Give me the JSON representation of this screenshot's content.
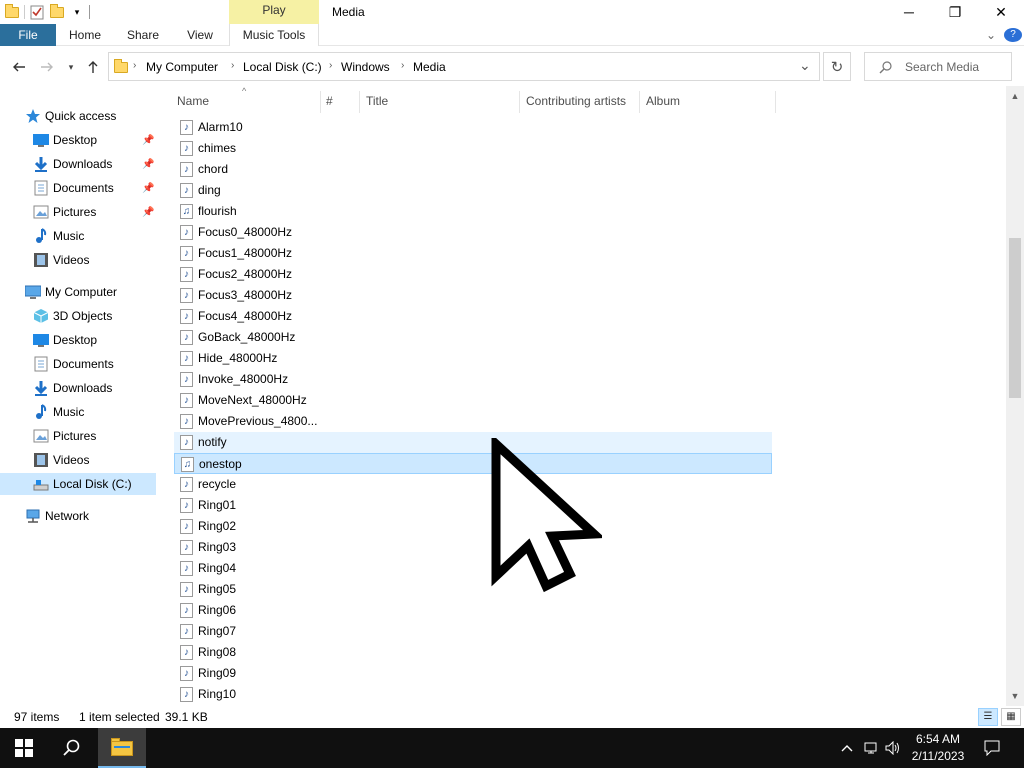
{
  "titlebar": {
    "contextual_tab": "Play",
    "title": "Media",
    "minimize_glyph": "─",
    "maximize_glyph": "❐",
    "close_glyph": "✕"
  },
  "ribbon": {
    "tabs": [
      "File",
      "Home",
      "Share",
      "View",
      "Music Tools"
    ],
    "expand_glyph": "⌄",
    "help_glyph": "?"
  },
  "address_bar": {
    "crumbs": [
      "My Computer",
      "Local Disk (C:)",
      "Windows",
      "Media"
    ],
    "dropdown_glyph": "⌄",
    "refresh_glyph": "↻"
  },
  "search": {
    "placeholder": "Search Media"
  },
  "navigation": {
    "quick_access": {
      "label": "Quick access",
      "items": [
        {
          "label": "Desktop",
          "icon": "desktop-icon",
          "pinned": true
        },
        {
          "label": "Downloads",
          "icon": "downloads-icon",
          "pinned": true
        },
        {
          "label": "Documents",
          "icon": "documents-icon",
          "pinned": true
        },
        {
          "label": "Pictures",
          "icon": "pictures-icon",
          "pinned": true
        },
        {
          "label": "Music",
          "icon": "music-icon",
          "pinned": false
        },
        {
          "label": "Videos",
          "icon": "videos-icon",
          "pinned": false
        }
      ]
    },
    "my_computer": {
      "label": "My Computer",
      "items": [
        {
          "label": "3D Objects",
          "icon": "3d-objects-icon"
        },
        {
          "label": "Desktop",
          "icon": "desktop-icon"
        },
        {
          "label": "Documents",
          "icon": "documents-icon"
        },
        {
          "label": "Downloads",
          "icon": "downloads-icon"
        },
        {
          "label": "Music",
          "icon": "music-icon"
        },
        {
          "label": "Pictures",
          "icon": "pictures-icon"
        },
        {
          "label": "Videos",
          "icon": "videos-icon"
        },
        {
          "label": "Local Disk (C:)",
          "icon": "drive-icon",
          "selected": true
        }
      ]
    },
    "network": {
      "label": "Network"
    }
  },
  "columns": {
    "name": "Name",
    "number": "#",
    "title": "Title",
    "artists": "Contributing artists",
    "album": "Album"
  },
  "files": [
    {
      "name": "Alarm10",
      "icon": "audio-file-icon"
    },
    {
      "name": "chimes",
      "icon": "audio-file-icon"
    },
    {
      "name": "chord",
      "icon": "audio-file-icon"
    },
    {
      "name": "ding",
      "icon": "audio-file-icon"
    },
    {
      "name": "flourish",
      "icon": "midi-file-icon"
    },
    {
      "name": "Focus0_48000Hz",
      "icon": "audio-file-icon"
    },
    {
      "name": "Focus1_48000Hz",
      "icon": "audio-file-icon"
    },
    {
      "name": "Focus2_48000Hz",
      "icon": "audio-file-icon"
    },
    {
      "name": "Focus3_48000Hz",
      "icon": "audio-file-icon"
    },
    {
      "name": "Focus4_48000Hz",
      "icon": "audio-file-icon"
    },
    {
      "name": "GoBack_48000Hz",
      "icon": "audio-file-icon"
    },
    {
      "name": "Hide_48000Hz",
      "icon": "audio-file-icon"
    },
    {
      "name": "Invoke_48000Hz",
      "icon": "audio-file-icon"
    },
    {
      "name": "MoveNext_48000Hz",
      "icon": "audio-file-icon"
    },
    {
      "name": "MovePrevious_4800...",
      "icon": "audio-file-icon"
    },
    {
      "name": "notify",
      "icon": "audio-file-icon",
      "state": "hover"
    },
    {
      "name": "onestop",
      "icon": "midi-file-icon",
      "state": "selected"
    },
    {
      "name": "recycle",
      "icon": "audio-file-icon"
    },
    {
      "name": "Ring01",
      "icon": "audio-file-icon"
    },
    {
      "name": "Ring02",
      "icon": "audio-file-icon"
    },
    {
      "name": "Ring03",
      "icon": "audio-file-icon"
    },
    {
      "name": "Ring04",
      "icon": "audio-file-icon"
    },
    {
      "name": "Ring05",
      "icon": "audio-file-icon"
    },
    {
      "name": "Ring06",
      "icon": "audio-file-icon"
    },
    {
      "name": "Ring07",
      "icon": "audio-file-icon"
    },
    {
      "name": "Ring08",
      "icon": "audio-file-icon"
    },
    {
      "name": "Ring09",
      "icon": "audio-file-icon"
    },
    {
      "name": "Ring10",
      "icon": "audio-file-icon"
    }
  ],
  "status": {
    "item_count": "97 items",
    "selection": "1 item selected",
    "size": "39.1 KB"
  },
  "taskbar": {
    "time": "6:54 AM",
    "date": "2/11/2023"
  },
  "colors": {
    "file_tab": "#2b6f9c",
    "contextual_tab": "#f6f1a4",
    "selection": "#cce8ff",
    "hover": "#e5f3ff",
    "taskbar": "#101010"
  }
}
